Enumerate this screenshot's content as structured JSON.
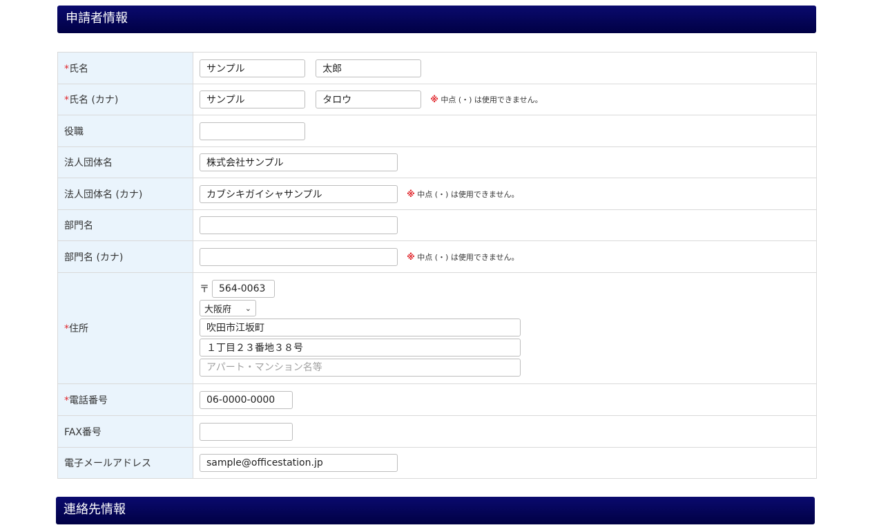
{
  "section1": {
    "title": "申請者情報"
  },
  "section2": {
    "title": "連絡先情報"
  },
  "required_mark": "*",
  "note": {
    "mark": "※",
    "text": "中点 (・) は使用できません。"
  },
  "fields": {
    "name": {
      "label": "氏名",
      "last": "サンプル",
      "first": "太郎"
    },
    "name_kana": {
      "label": "氏名 (カナ)",
      "last": "サンプル",
      "first": "タロウ"
    },
    "position": {
      "label": "役職",
      "value": ""
    },
    "company": {
      "label": "法人団体名",
      "value": "株式会社サンプル"
    },
    "company_kana": {
      "label": "法人団体名 (カナ)",
      "value": "カブシキガイシャサンプル"
    },
    "department": {
      "label": "部門名",
      "value": ""
    },
    "department_kana": {
      "label": "部門名 (カナ)",
      "value": ""
    },
    "address": {
      "label": "住所",
      "zip_mark": "〒",
      "zip": "564-0063",
      "prefecture": "大阪府",
      "city": "吹田市江坂町",
      "street": "１丁目２３番地３８号",
      "building": "",
      "building_placeholder": "アパート・マンション名等"
    },
    "phone": {
      "label": "電話番号",
      "value": "06-0000-0000"
    },
    "fax": {
      "label": "FAX番号",
      "value": ""
    },
    "email": {
      "label": "電子メールアドレス",
      "value": "sample@officestation.jp"
    }
  },
  "colors": {
    "header_bg": "#000044",
    "label_bg": "#eaf4fc",
    "required": "#e0262c"
  }
}
